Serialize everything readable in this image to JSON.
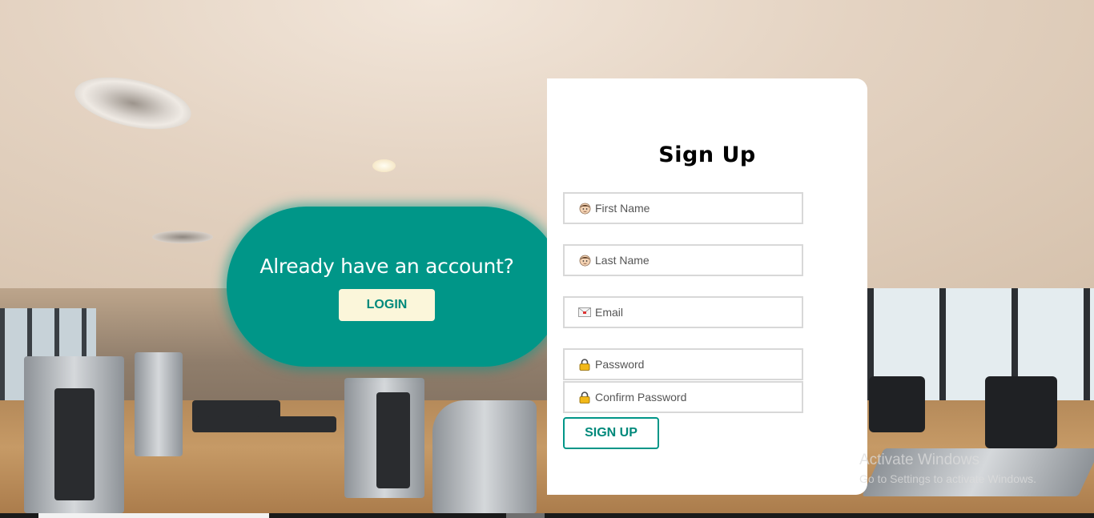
{
  "login_panel": {
    "heading": "Already have an account?",
    "button_label": "LOGIN",
    "color": "#009688",
    "button_bg": "#fbf6da"
  },
  "signup_form": {
    "heading": "Sign Up",
    "fields": [
      {
        "placeholder": "First Name",
        "value": "",
        "icon": "person-icon"
      },
      {
        "placeholder": "Last Name",
        "value": "",
        "icon": "person-icon"
      },
      {
        "placeholder": "Email",
        "value": "",
        "icon": "envelope-icon"
      },
      {
        "placeholder": "Password",
        "value": "",
        "icon": "lock-icon"
      },
      {
        "placeholder": "Confirm Password",
        "value": "",
        "icon": "lock-icon"
      }
    ],
    "submit_label": "SIGN UP",
    "accent": "#009688"
  },
  "watermark": {
    "title": "Activate Windows",
    "subtitle": "Go to Settings to activate Windows."
  }
}
